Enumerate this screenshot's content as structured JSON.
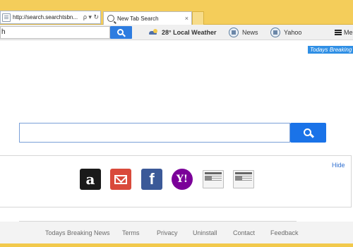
{
  "browser": {
    "address_url": "http://search.searchtsbn...",
    "address_controls": "ρ ▾ ↻",
    "tab_title": "New Tab Search",
    "tab_close": "×"
  },
  "toolbar": {
    "search_value": "h",
    "weather_label": "28° Local Weather",
    "news_label": "News",
    "yahoo_label": "Yahoo",
    "menu_label": "Me"
  },
  "page": {
    "breaking_label": "Todays Breaking N",
    "search_placeholder": "",
    "hide_label": "Hide",
    "shortcuts": [
      {
        "name": "amazon",
        "glyph": "a"
      },
      {
        "name": "gmail",
        "glyph": ""
      },
      {
        "name": "facebook",
        "glyph": "f"
      },
      {
        "name": "yahoo",
        "glyph": "Y!"
      },
      {
        "name": "newspaper-1",
        "glyph": ""
      },
      {
        "name": "newspaper-2",
        "glyph": ""
      }
    ]
  },
  "footer": {
    "links": [
      "Todays Breaking News",
      "Terms",
      "Privacy",
      "Uninstall",
      "Contact",
      "Feedback"
    ]
  },
  "colors": {
    "chrome_accent": "#f2c94c",
    "search_button": "#1a73e8",
    "link_blue": "#2f6fd0"
  }
}
